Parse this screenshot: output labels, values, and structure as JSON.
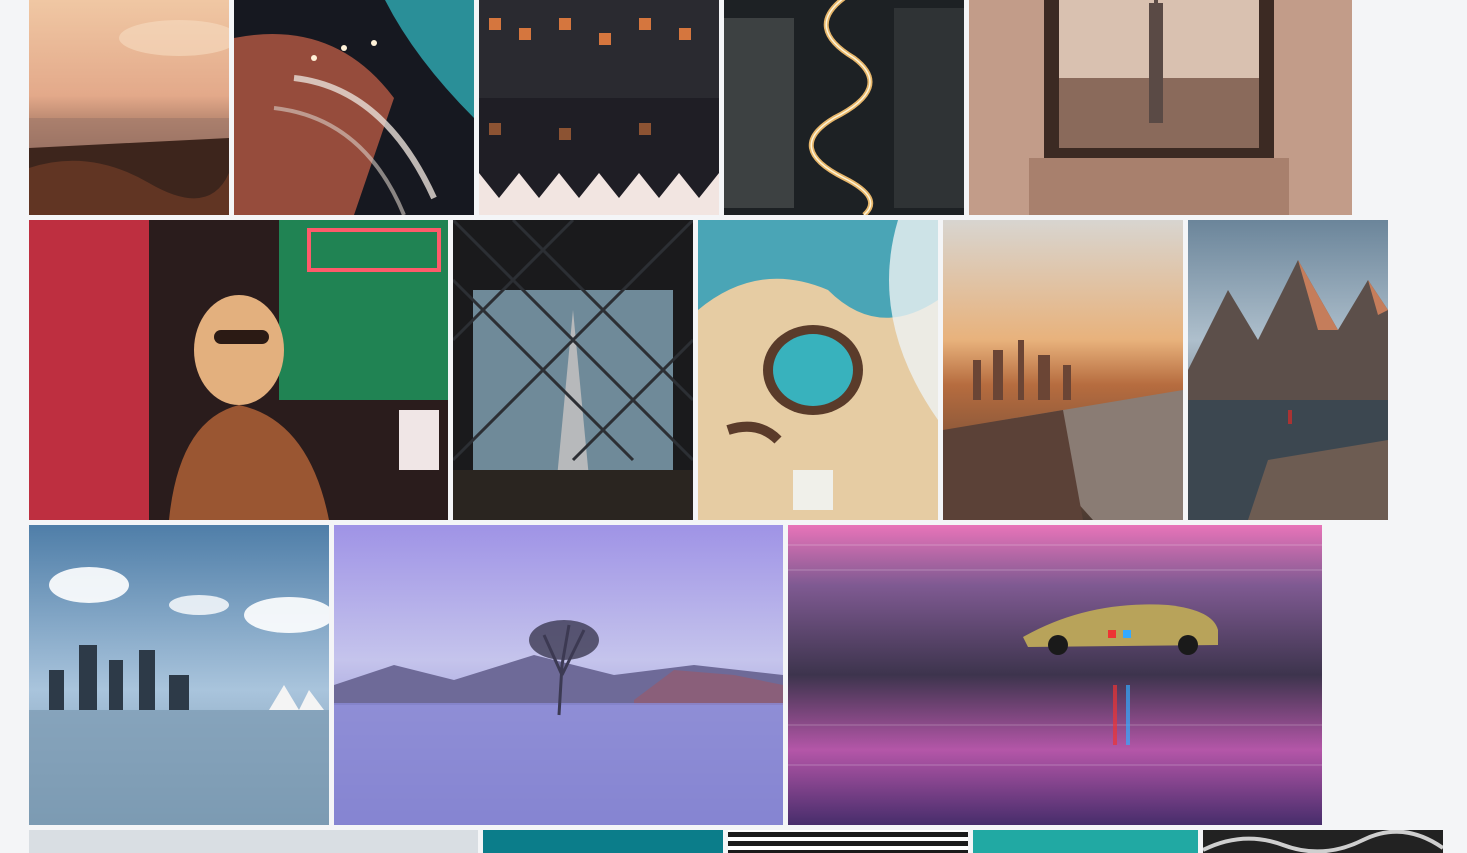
{
  "gallery": {
    "background": "#f4f5f7",
    "rows": [
      {
        "tiles": [
          {
            "subject": "paris-rooftops-sunset",
            "colors": [
              "#e7b48a",
              "#9b6f58",
              "#3a241c"
            ]
          },
          {
            "subject": "spiral-staircase-neon",
            "colors": [
              "#2b8f98",
              "#b65b43",
              "#14151b"
            ]
          },
          {
            "subject": "canal-houses-reflection",
            "colors": [
              "#2a2a30",
              "#d5763e",
              "#f3e6e2"
            ]
          },
          {
            "subject": "winding-road-night",
            "colors": [
              "#1f2326",
              "#e7b66c",
              "#3d4040"
            ]
          },
          {
            "subject": "empire-state-window",
            "colors": [
              "#c5a08e",
              "#6e4b3b",
              "#3a2a24"
            ]
          }
        ]
      },
      {
        "tiles": [
          {
            "subject": "neon-shop-portrait",
            "colors": [
              "#e0344a",
              "#1ea566",
              "#2b1b1a"
            ]
          },
          {
            "subject": "bridge-through-fence",
            "colors": [
              "#2c2f34",
              "#6f8a99",
              "#1a1a1c"
            ]
          },
          {
            "subject": "aerial-tide-pool",
            "colors": [
              "#e5c9a0",
              "#3aa7b5",
              "#5b3b2a"
            ]
          },
          {
            "subject": "city-aerial-sunset",
            "colors": [
              "#e9b27a",
              "#b0673e",
              "#5b4137"
            ]
          },
          {
            "subject": "mountain-lake-hiker",
            "colors": [
              "#8aa0b1",
              "#c57d5b",
              "#2b2e33"
            ]
          }
        ]
      },
      {
        "tiles": [
          {
            "subject": "harbour-skyline",
            "colors": [
              "#6c9ac4",
              "#ffffff",
              "#2d3a48"
            ]
          },
          {
            "subject": "lone-tree-lake",
            "colors": [
              "#a79fe2",
              "#7b7ed0",
              "#3c3a53"
            ]
          },
          {
            "subject": "race-car-motion-blur",
            "colors": [
              "#e073b6",
              "#5a3b77",
              "#2a2239"
            ]
          }
        ]
      },
      {
        "tiles": [
          {
            "subject": "misty-light",
            "colors": [
              "#d9dee3"
            ]
          },
          {
            "subject": "teal-abstract",
            "colors": [
              "#0b7d8a"
            ]
          },
          {
            "subject": "black-stripes",
            "colors": [
              "#1b1b1b",
              "#ffffff"
            ]
          },
          {
            "subject": "turquoise-water",
            "colors": [
              "#21a9a3"
            ]
          },
          {
            "subject": "monochrome-texture",
            "colors": [
              "#222",
              "#cfcfcf"
            ]
          }
        ]
      }
    ]
  }
}
